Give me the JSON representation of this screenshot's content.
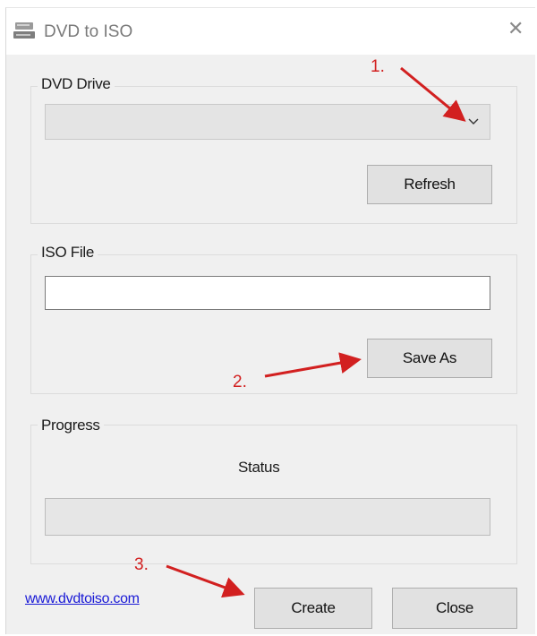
{
  "window": {
    "title": "DVD to ISO",
    "icon": "dvd-drive-icon"
  },
  "dvd_drive": {
    "group_label": "DVD Drive",
    "selected_value": "",
    "refresh_label": "Refresh"
  },
  "iso_file": {
    "group_label": "ISO File",
    "value": "",
    "save_as_label": "Save As"
  },
  "progress": {
    "group_label": "Progress",
    "status_text": "Status",
    "level": 0
  },
  "footer": {
    "link_text": "www.dvdtoiso.com",
    "create_label": "Create",
    "close_label": "Close"
  },
  "annotations": {
    "step1": "1.",
    "step2": "2.",
    "step3": "3.",
    "color": "#d22020"
  }
}
